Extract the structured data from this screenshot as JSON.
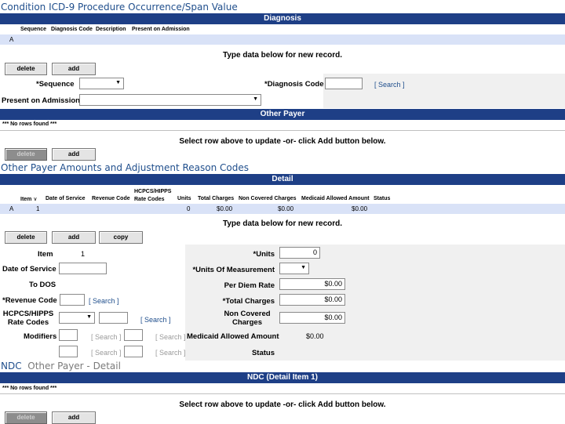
{
  "sections": {
    "condition_title": "Condition ICD-9 Procedure Occurrence/Span Value",
    "diagnosis_bar": "Diagnosis",
    "other_payer_bar": "Other Payer",
    "amounts_title": "Other Payer Amounts and Adjustment Reason Codes",
    "detail_bar": "Detail",
    "ndc_title": "NDC",
    "ndc_subtitle": "Other Payer - Detail",
    "ndc_bar": "NDC (Detail Item 1)"
  },
  "diagnosis": {
    "columns": [
      "Sequence",
      "Diagnosis Code",
      "Description",
      "Present on Admission"
    ],
    "row_marker": "A",
    "new_record_msg": "Type data below for new record.",
    "delete_label": "delete",
    "add_label": "add",
    "sequence_label": "*Sequence",
    "diag_code_label": "*Diagnosis Code",
    "search_label": "[ Search ]",
    "poa_label": "Present on Admission"
  },
  "other_payer": {
    "no_rows": "*** No rows found ***",
    "select_msg": "Select row above to update -or- click Add button below.",
    "delete_label": "delete",
    "add_label": "add"
  },
  "detail": {
    "columns": [
      "Item",
      "Date of Service",
      "Revenue Code",
      "HCPCS/HIPPS Rate Codes",
      "Units",
      "Total Charges",
      "Non Covered Charges",
      "Medicaid Allowed Amount",
      "Status"
    ],
    "sort_glyph": "∨",
    "row": {
      "marker": "A",
      "item": "1",
      "units": "0",
      "total": "$0.00",
      "noncovered": "$0.00",
      "allowed": "$0.00"
    },
    "new_record_msg": "Type data below for new record.",
    "delete_label": "delete",
    "add_label": "add",
    "copy_label": "copy",
    "form": {
      "item_label": "Item",
      "item_value": "1",
      "dos_label": "Date of Service",
      "todos_label": "To DOS",
      "revenue_label": "*Revenue Code",
      "hcpcs_label": "HCPCS/HIPPS Rate Codes",
      "modifiers_label": "Modifiers",
      "search_label": "[ Search ]",
      "units_label": "*Units",
      "units_value": "0",
      "uom_label": "*Units Of Measurement",
      "perdiem_label": "Per Diem Rate",
      "perdiem_value": "$0.00",
      "total_label": "*Total Charges",
      "total_value": "$0.00",
      "noncovered_label": "Non Covered Charges",
      "noncovered_value": "$0.00",
      "allowed_label": "Medicaid Allowed Amount",
      "allowed_value": "$0.00",
      "status_label": "Status"
    }
  },
  "ndc": {
    "no_rows": "*** No rows found ***",
    "select_msg": "Select row above to update -or- click Add button below.",
    "delete_label": "delete",
    "add_label": "add"
  },
  "colors": {
    "bar": "#1e3f86",
    "title": "#1f4e8c",
    "selected_row": "#d9e2f7"
  }
}
